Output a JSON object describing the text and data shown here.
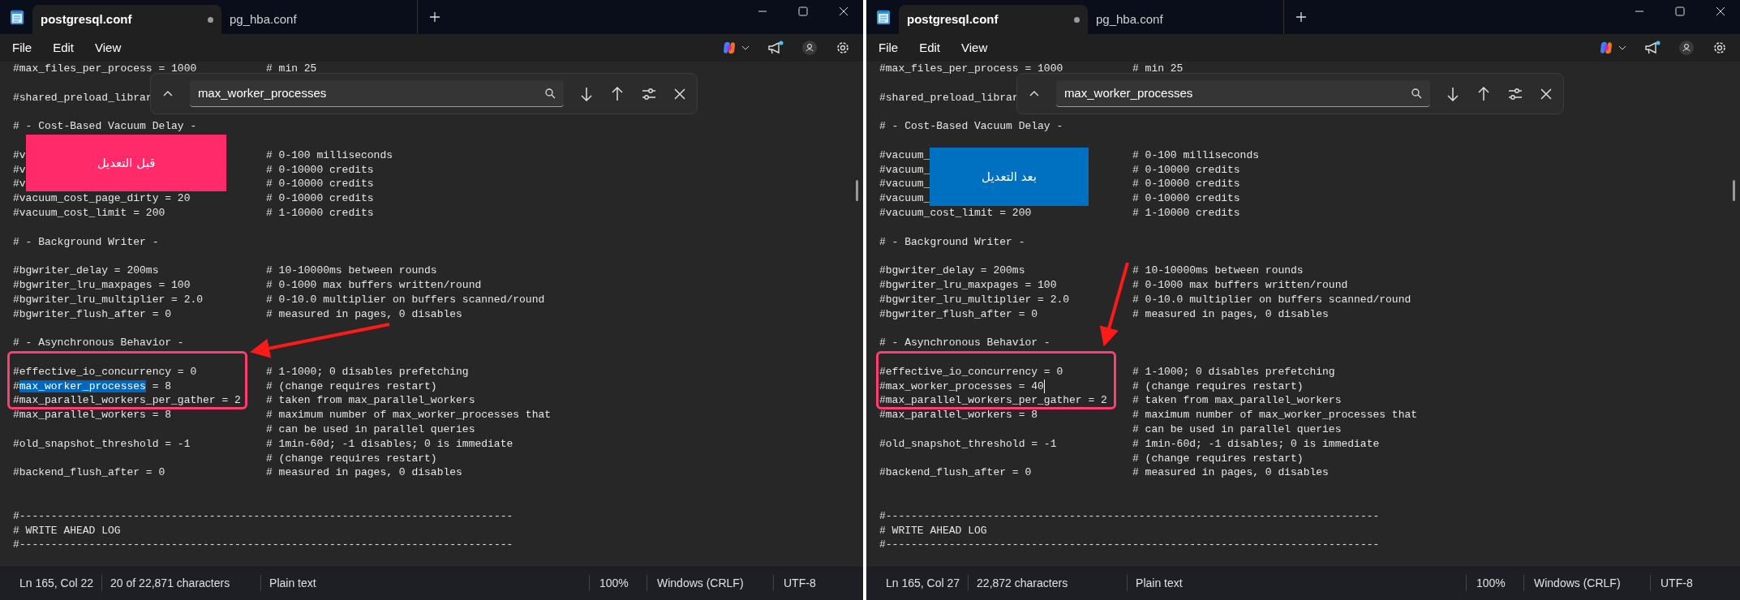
{
  "windows": [
    {
      "tabs": [
        {
          "label": "postgresql.conf",
          "selected": true,
          "modified": true
        },
        {
          "label": "pg_hba.conf",
          "selected": false,
          "modified": false
        }
      ],
      "menu": [
        "File",
        "Edit",
        "View"
      ],
      "find": {
        "value": "max_worker_processes"
      },
      "annotation": {
        "label": "قبل التعديل",
        "color": "#ff2a6a"
      },
      "lines": [
        {
          "kind": "code",
          "code": [
            {
              "text": "#max_files_per_process = 1000",
              "selected": false
            }
          ],
          "comment": "# min 25"
        },
        {
          "kind": "blank"
        },
        {
          "kind": "code",
          "code": [
            {
              "text": "#shared_preload_librar",
              "selected": false
            }
          ]
        },
        {
          "kind": "blank"
        },
        {
          "kind": "code",
          "code": [
            {
              "text": "# - Cost-Based Vacuum Delay -",
              "selected": false
            }
          ]
        },
        {
          "kind": "blank"
        },
        {
          "kind": "code",
          "code": [
            {
              "text": "#v",
              "selected": false
            }
          ],
          "comment": "# 0-100 milliseconds"
        },
        {
          "kind": "code",
          "code": [
            {
              "text": "#v",
              "selected": false
            }
          ],
          "comment": "# 0-10000 credits"
        },
        {
          "kind": "code",
          "code": [
            {
              "text": "#v",
              "selected": false
            }
          ],
          "comment": "# 0-10000 credits"
        },
        {
          "kind": "code",
          "code": [
            {
              "text": "#vacuum_cost_page_dirty = 20",
              "selected": false
            }
          ],
          "comment": "# 0-10000 credits"
        },
        {
          "kind": "code",
          "code": [
            {
              "text": "#vacuum_cost_limit = 200",
              "selected": false
            }
          ],
          "comment": "# 1-10000 credits"
        },
        {
          "kind": "blank"
        },
        {
          "kind": "code",
          "code": [
            {
              "text": "# - Background Writer -",
              "selected": false
            }
          ]
        },
        {
          "kind": "blank"
        },
        {
          "kind": "code",
          "code": [
            {
              "text": "#bgwriter_delay = 200ms",
              "selected": false
            }
          ],
          "comment": "# 10-10000ms between rounds"
        },
        {
          "kind": "code",
          "code": [
            {
              "text": "#bgwriter_lru_maxpages = 100",
              "selected": false
            }
          ],
          "comment": "# 0-1000 max buffers written/round"
        },
        {
          "kind": "code",
          "code": [
            {
              "text": "#bgwriter_lru_multiplier = 2.0",
              "selected": false
            }
          ],
          "comment": "# 0-10.0 multiplier on buffers scanned/round"
        },
        {
          "kind": "code",
          "code": [
            {
              "text": "#bgwriter_flush_after = 0",
              "selected": false
            }
          ],
          "comment": "# measured in pages, 0 disables"
        },
        {
          "kind": "blank"
        },
        {
          "kind": "code",
          "code": [
            {
              "text": "# - Asynchronous Behavior -",
              "selected": false
            }
          ]
        },
        {
          "kind": "blank"
        },
        {
          "kind": "code",
          "code": [
            {
              "text": "#effective_io_concurrency = 0",
              "selected": false
            }
          ],
          "comment": "# 1-1000; 0 disables prefetching"
        },
        {
          "kind": "code",
          "code": [
            {
              "text": "#",
              "selected": false
            },
            {
              "text": "max_worker_processes",
              "selected": true
            },
            {
              "text": " = 8",
              "selected": false
            }
          ],
          "comment": "# (change requires restart)"
        },
        {
          "kind": "code",
          "code": [
            {
              "text": "#max_parallel_workers_per_gather = 2",
              "selected": false
            }
          ],
          "comment": "# taken from max_parallel_workers"
        },
        {
          "kind": "code",
          "code": [
            {
              "text": "#max_parallel_workers = 8",
              "selected": false
            }
          ],
          "comment": "# maximum number of max_worker_processes that"
        },
        {
          "kind": "code",
          "comment": "# can be used in parallel queries"
        },
        {
          "kind": "code",
          "code": [
            {
              "text": "#old_snapshot_threshold = -1",
              "selected": false
            }
          ],
          "comment": "# 1min-60d; -1 disables; 0 is immediate"
        },
        {
          "kind": "code",
          "comment": "# (change requires restart)"
        },
        {
          "kind": "code",
          "code": [
            {
              "text": "#backend_flush_after = 0",
              "selected": false
            }
          ],
          "comment": "# measured in pages, 0 disables"
        },
        {
          "kind": "blank"
        },
        {
          "kind": "blank"
        },
        {
          "kind": "code",
          "code": [
            {
              "text": "#------------------------------------------------------------------------------",
              "selected": false
            }
          ]
        },
        {
          "kind": "code",
          "code": [
            {
              "text": "# WRITE AHEAD LOG",
              "selected": false
            }
          ]
        },
        {
          "kind": "code",
          "code": [
            {
              "text": "#------------------------------------------------------------------------------",
              "selected": false
            }
          ]
        }
      ],
      "status": {
        "position": "Ln 165, Col 22",
        "characters": "20 of 22,871 characters",
        "format": "Plain text",
        "zoom": "100%",
        "line_ending": "Windows (CRLF)",
        "encoding": "UTF-8"
      }
    },
    {
      "tabs": [
        {
          "label": "postgresql.conf",
          "selected": true,
          "modified": true
        },
        {
          "label": "pg_hba.conf",
          "selected": false,
          "modified": false
        }
      ],
      "menu": [
        "File",
        "Edit",
        "View"
      ],
      "find": {
        "value": "max_worker_processes"
      },
      "annotation": {
        "label": "بعد التعديل",
        "color": "#0070c0"
      },
      "lines": [
        {
          "kind": "code",
          "code": [
            {
              "text": "#max_files_per_process = 1000",
              "selected": false
            }
          ],
          "comment": "# min 25"
        },
        {
          "kind": "blank"
        },
        {
          "kind": "code",
          "code": [
            {
              "text": "#shared_preload_librar",
              "selected": false
            }
          ]
        },
        {
          "kind": "blank"
        },
        {
          "kind": "code",
          "code": [
            {
              "text": "# - Cost-Based Vacuum Delay -",
              "selected": false
            }
          ]
        },
        {
          "kind": "blank"
        },
        {
          "kind": "code",
          "code": [
            {
              "text": "#vacuum_",
              "selected": false
            }
          ],
          "comment": "# 0-100 milliseconds"
        },
        {
          "kind": "code",
          "code": [
            {
              "text": "#vacuum_",
              "selected": false
            }
          ],
          "comment": "# 0-10000 credits"
        },
        {
          "kind": "code",
          "code": [
            {
              "text": "#vacuum_",
              "selected": false
            }
          ],
          "comment": "# 0-10000 credits"
        },
        {
          "kind": "code",
          "code": [
            {
              "text": "#vacuum_",
              "selected": false
            }
          ],
          "comment": "# 0-10000 credits"
        },
        {
          "kind": "code",
          "code": [
            {
              "text": "#vacuum_cost_limit = 200",
              "selected": false
            }
          ],
          "comment": "# 1-10000 credits"
        },
        {
          "kind": "blank"
        },
        {
          "kind": "code",
          "code": [
            {
              "text": "# - Background Writer -",
              "selected": false
            }
          ]
        },
        {
          "kind": "blank"
        },
        {
          "kind": "code",
          "code": [
            {
              "text": "#bgwriter_delay = 200ms",
              "selected": false
            }
          ],
          "comment": "# 10-10000ms between rounds"
        },
        {
          "kind": "code",
          "code": [
            {
              "text": "#bgwriter_lru_maxpages = 100",
              "selected": false
            }
          ],
          "comment": "# 0-1000 max buffers written/round"
        },
        {
          "kind": "code",
          "code": [
            {
              "text": "#bgwriter_lru_multiplier = 2.0",
              "selected": false
            }
          ],
          "comment": "# 0-10.0 multiplier on buffers scanned/round"
        },
        {
          "kind": "code",
          "code": [
            {
              "text": "#bgwriter_flush_after = 0",
              "selected": false
            }
          ],
          "comment": "# measured in pages, 0 disables"
        },
        {
          "kind": "blank"
        },
        {
          "kind": "code",
          "code": [
            {
              "text": "# - Asynchronous Behavior -",
              "selected": false
            }
          ]
        },
        {
          "kind": "blank"
        },
        {
          "kind": "code",
          "code": [
            {
              "text": "#effective_io_concurrency = 0",
              "selected": false
            }
          ],
          "comment": "# 1-1000; 0 disables prefetching"
        },
        {
          "kind": "code",
          "code": [
            {
              "text": "#max_worker_processes = 40",
              "selected": false
            }
          ],
          "caret": true,
          "comment": "# (change requires restart)"
        },
        {
          "kind": "code",
          "code": [
            {
              "text": "#max_parallel_workers_per_gather = 2",
              "selected": false
            }
          ],
          "comment": "# taken from max_parallel_workers"
        },
        {
          "kind": "code",
          "code": [
            {
              "text": "#max_parallel_workers = 8",
              "selected": false
            }
          ],
          "comment": "# maximum number of max_worker_processes that"
        },
        {
          "kind": "code",
          "comment": "# can be used in parallel queries"
        },
        {
          "kind": "code",
          "code": [
            {
              "text": "#old_snapshot_threshold = -1",
              "selected": false
            }
          ],
          "comment": "# 1min-60d; -1 disables; 0 is immediate"
        },
        {
          "kind": "code",
          "comment": "# (change requires restart)"
        },
        {
          "kind": "code",
          "code": [
            {
              "text": "#backend_flush_after = 0",
              "selected": false
            }
          ],
          "comment": "# measured in pages, 0 disables"
        },
        {
          "kind": "blank"
        },
        {
          "kind": "blank"
        },
        {
          "kind": "code",
          "code": [
            {
              "text": "#------------------------------------------------------------------------------",
              "selected": false
            }
          ]
        },
        {
          "kind": "code",
          "code": [
            {
              "text": "# WRITE AHEAD LOG",
              "selected": false
            }
          ]
        },
        {
          "kind": "code",
          "code": [
            {
              "text": "#------------------------------------------------------------------------------",
              "selected": false
            }
          ]
        }
      ],
      "status": {
        "position": "Ln 165, Col 27",
        "characters": "22,872 characters",
        "format": "Plain text",
        "zoom": "100%",
        "line_ending": "Windows (CRLF)",
        "encoding": "UTF-8"
      }
    }
  ]
}
